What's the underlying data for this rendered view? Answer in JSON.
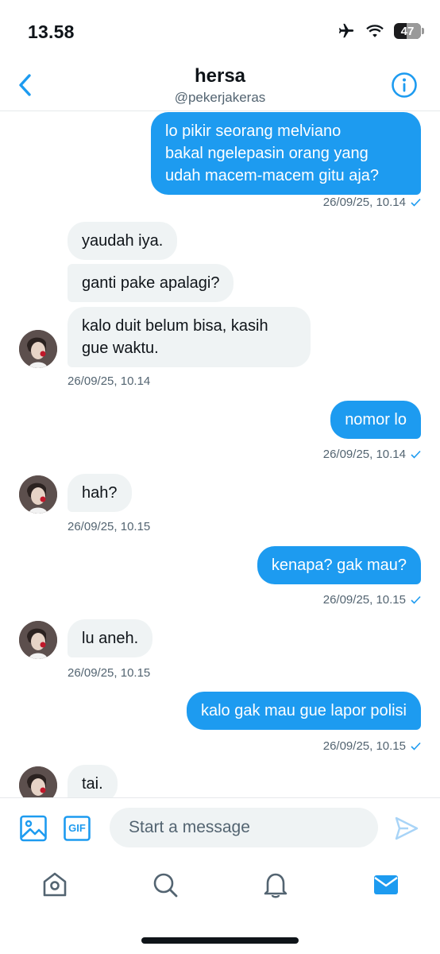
{
  "status_bar": {
    "time": "13.58",
    "battery": "47",
    "battery_fraction": 0.47,
    "icons": [
      "airplane-icon",
      "wifi-icon",
      "battery-icon"
    ]
  },
  "header": {
    "name": "hersa",
    "handle": "@pekerjakeras",
    "back_icon": "chevron-left-icon",
    "info_icon": "info-icon"
  },
  "colors": {
    "accent": "#1d9bf0",
    "received_bubble": "#eff3f4",
    "muted_text": "#536471"
  },
  "messages": [
    {
      "from": "me",
      "text": "lo pikir seorang melviano\nbakal ngelepasin orang yang\nudah macem-macem gitu aja?",
      "timestamp": "26/09/25, 10.14"
    },
    {
      "from": "them",
      "text": "yaudah iya."
    },
    {
      "from": "them",
      "text": "ganti pake apalagi?"
    },
    {
      "from": "them",
      "text": "kalo duit belum bisa, kasih\ngue waktu.",
      "timestamp": "26/09/25, 10.14"
    },
    {
      "from": "me",
      "text": "nomor lo",
      "timestamp": "26/09/25, 10.14"
    },
    {
      "from": "them",
      "text": "hah?",
      "timestamp": "26/09/25, 10.15"
    },
    {
      "from": "me",
      "text": "kenapa? gak mau?",
      "timestamp": "26/09/25, 10.15"
    },
    {
      "from": "them",
      "text": "lu aneh.",
      "timestamp": "26/09/25, 10.15"
    },
    {
      "from": "me",
      "text": "kalo gak mau gue lapor polisi",
      "timestamp": "26/09/25, 10.15"
    },
    {
      "from": "them",
      "text": "tai."
    }
  ],
  "composer": {
    "placeholder": "Start a message",
    "value": "",
    "gif_label": "GIF",
    "image_icon": "image-icon",
    "send_icon": "send-icon"
  },
  "tabbar": {
    "tabs": [
      {
        "name": "home",
        "icon": "home-icon",
        "active": false
      },
      {
        "name": "search",
        "icon": "search-icon",
        "active": false
      },
      {
        "name": "notifications",
        "icon": "bell-icon",
        "active": false
      },
      {
        "name": "messages",
        "icon": "mail-icon",
        "active": true
      }
    ]
  }
}
